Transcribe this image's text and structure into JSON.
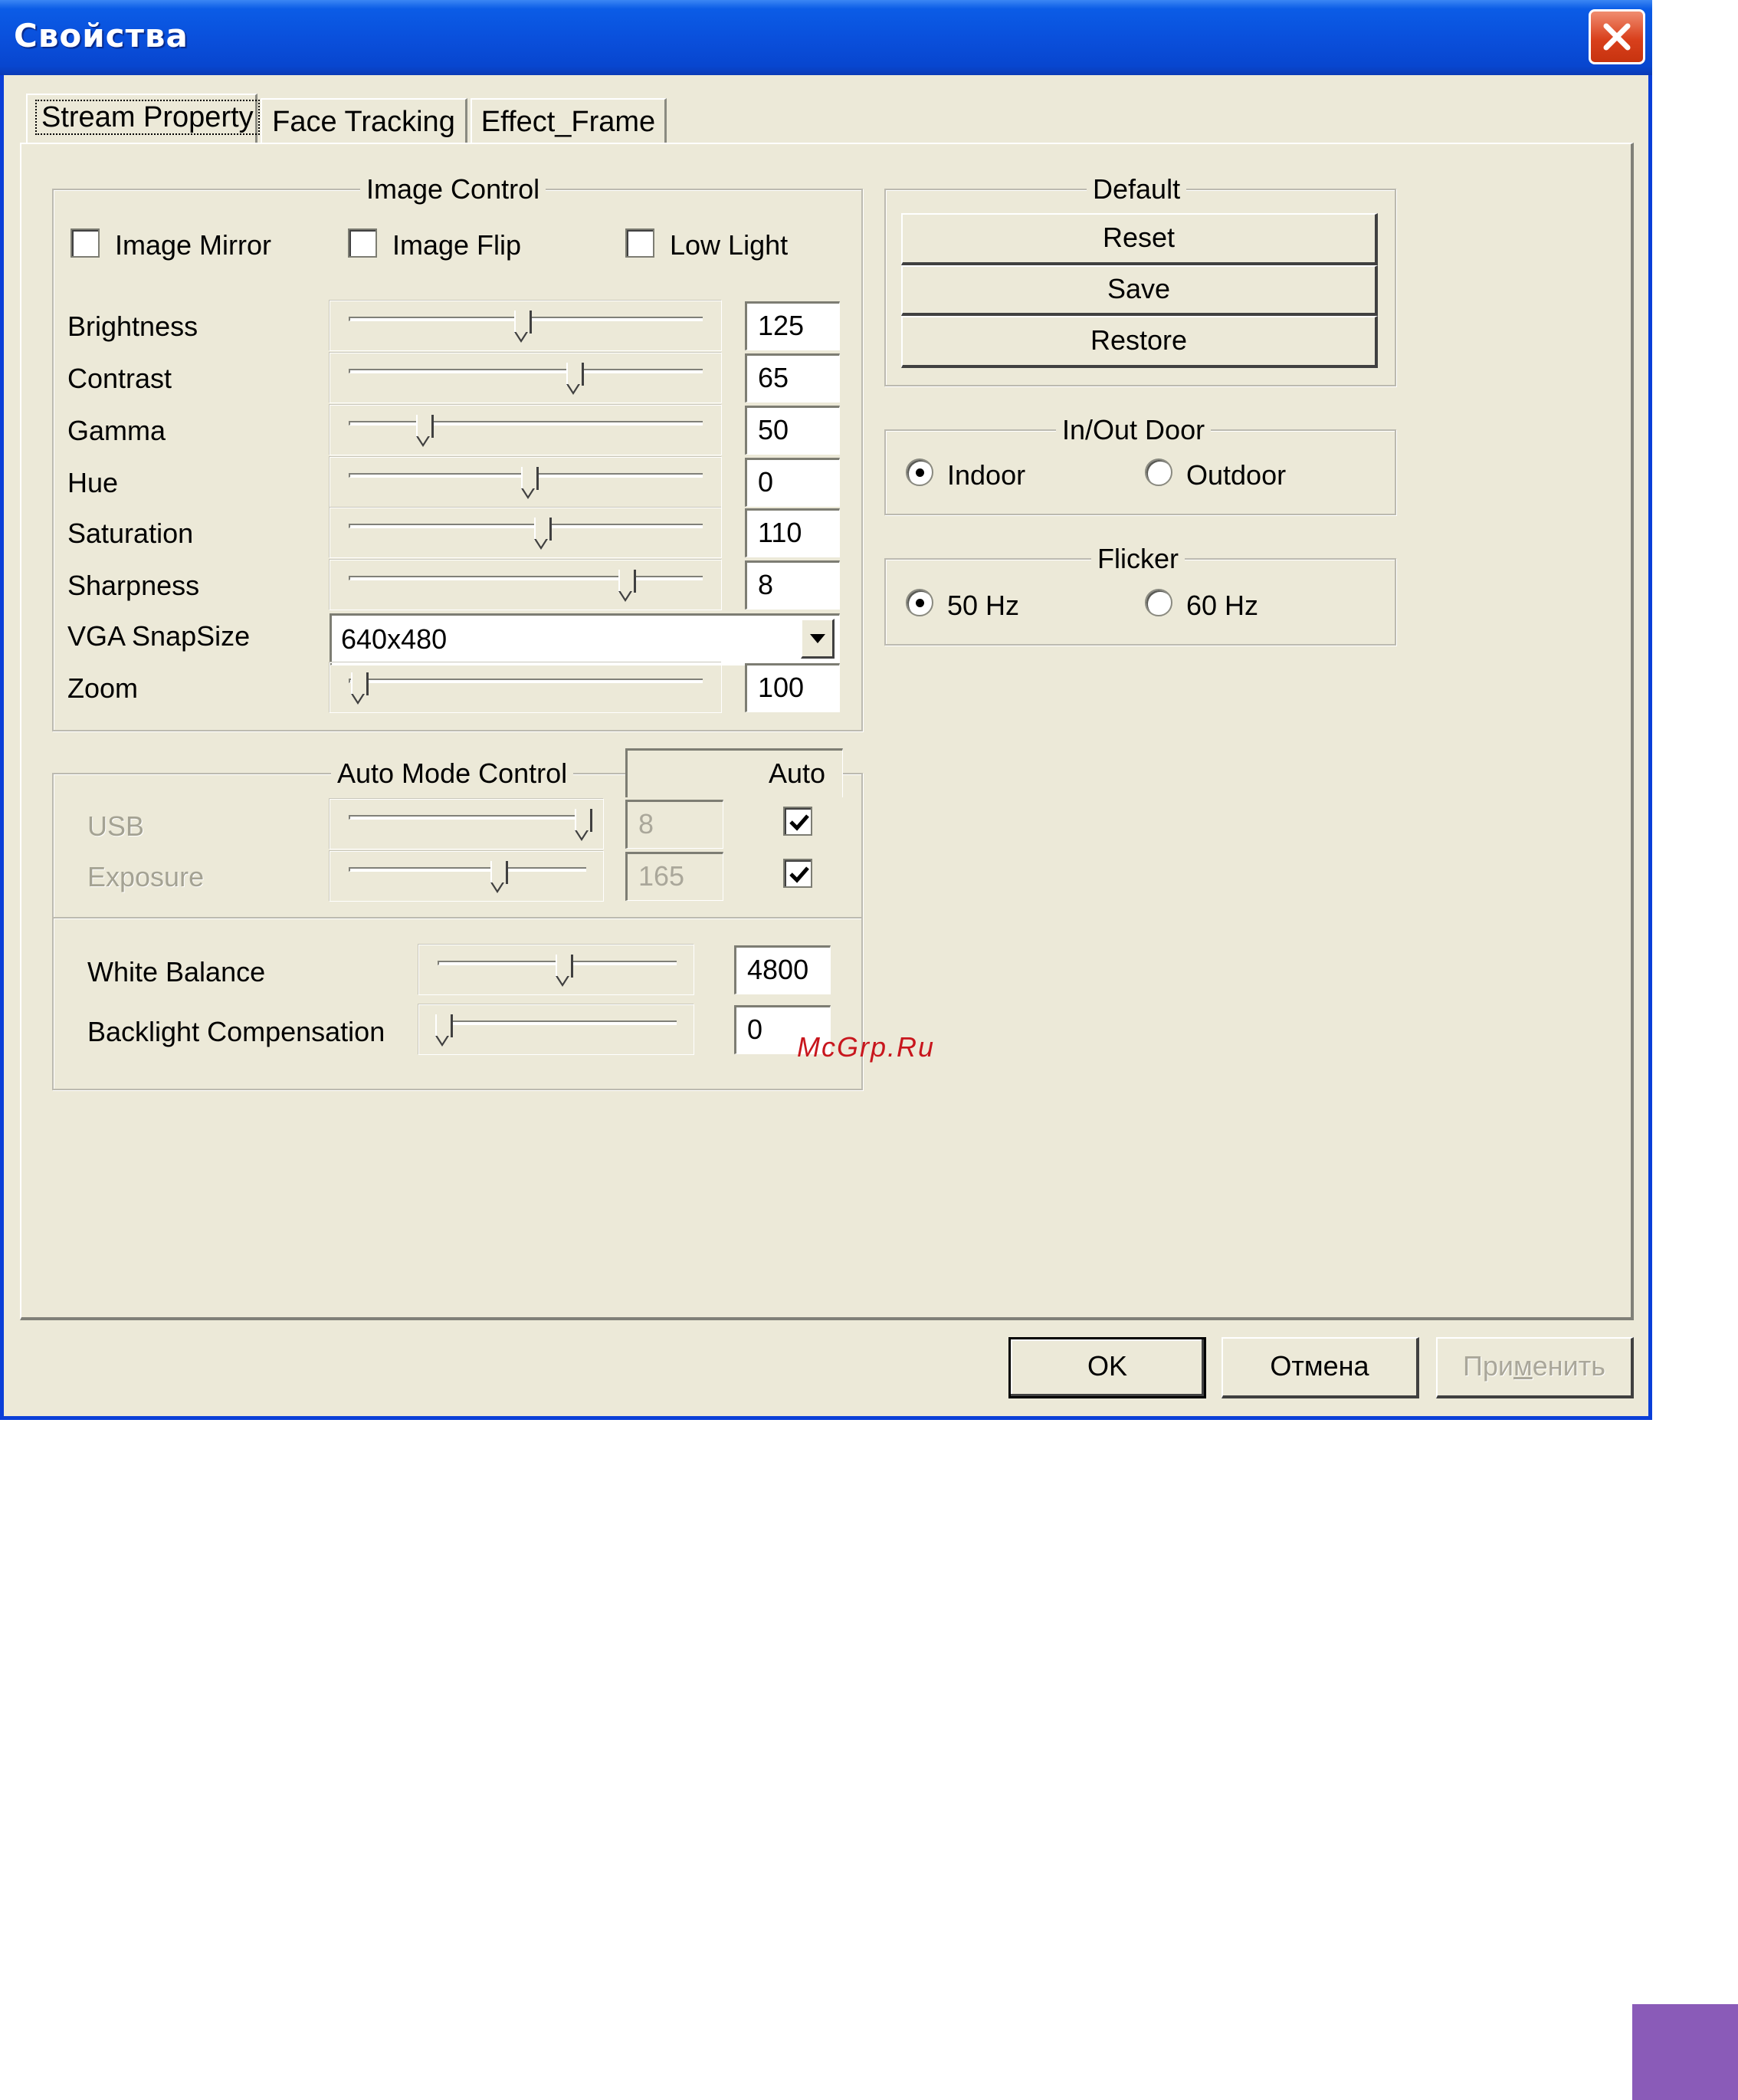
{
  "window": {
    "title": "Свойства"
  },
  "tabs": [
    {
      "label": "Stream Property",
      "active": true
    },
    {
      "label": "Face Tracking",
      "active": false
    },
    {
      "label": "Effect_Frame",
      "active": false
    }
  ],
  "image_control": {
    "title": "Image Control",
    "checkboxes": [
      {
        "label": "Image Mirror",
        "checked": false
      },
      {
        "label": "Image Flip",
        "checked": false
      },
      {
        "label": "Low Light",
        "checked": false
      }
    ],
    "sliders": [
      {
        "label": "Brightness",
        "value": "125",
        "position": 0.5
      },
      {
        "label": "Contrast",
        "value": "65",
        "position": 0.66
      },
      {
        "label": "Gamma",
        "value": "50",
        "position": 0.2
      },
      {
        "label": "Hue",
        "value": "0",
        "position": 0.52
      },
      {
        "label": "Saturation",
        "value": "110",
        "position": 0.56
      },
      {
        "label": "Sharpness",
        "value": "8",
        "position": 0.82
      }
    ],
    "snapsize": {
      "label": "VGA SnapSize",
      "value": "640x480"
    },
    "zoom": {
      "label": "Zoom",
      "value": "100",
      "position": 0.0
    }
  },
  "auto_mode": {
    "title": "Auto Mode Control",
    "auto_header": "Auto",
    "rows": [
      {
        "label": "USB",
        "value": "8",
        "position": 1.0,
        "auto": true
      },
      {
        "label": "Exposure",
        "value": "165",
        "position": 0.63,
        "auto": true
      }
    ],
    "white_balance": {
      "label": "White Balance",
      "value": "4800",
      "position": 0.52
    },
    "backlight": {
      "label": "Backlight Compensation",
      "value": "0",
      "position": 0.0
    }
  },
  "default_group": {
    "title": "Default",
    "buttons": [
      "Reset",
      "Save",
      "Restore"
    ]
  },
  "inout_door": {
    "title": "In/Out Door",
    "options": [
      {
        "label": "Indoor",
        "selected": true
      },
      {
        "label": "Outdoor",
        "selected": false
      }
    ]
  },
  "flicker": {
    "title": "Flicker",
    "options": [
      {
        "label": "50 Hz",
        "selected": true
      },
      {
        "label": "60 Hz",
        "selected": false
      }
    ]
  },
  "footer": {
    "ok": "OK",
    "cancel": "Отмена",
    "apply_pre": "При",
    "apply_mnemonic": "м",
    "apply_post": "енить"
  },
  "watermark": "McGrp.Ru",
  "colors": {
    "titlebar": "#0a50dc",
    "face": "#ece9d8",
    "close": "#d9401c",
    "watermark": "#c8161d",
    "corner_block": "#8a5bb8"
  }
}
